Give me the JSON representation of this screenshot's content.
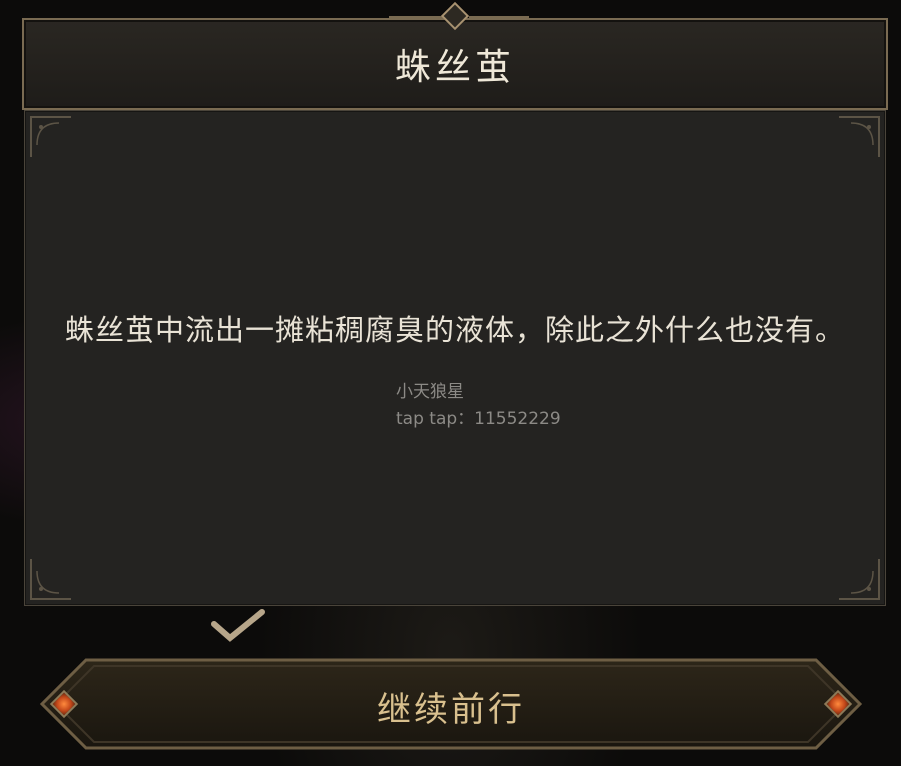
{
  "dialog": {
    "title": "蛛丝茧",
    "message": "蛛丝茧中流出一摊粘稠腐臭的液体，除此之外什么也没有。"
  },
  "watermark": {
    "line1": "小天狼星",
    "line2": "tap tap：11552229"
  },
  "actions": {
    "continue_label": "继续前行"
  },
  "colors": {
    "title_text": "#efe8d8",
    "button_text": "#d9c08e",
    "frame_gold": "#7a6b52",
    "gem_orange": "#ff8a3d"
  },
  "icons": [
    "ornament-corner-icon",
    "diamond-gem-icon",
    "checkmark-icon"
  ]
}
